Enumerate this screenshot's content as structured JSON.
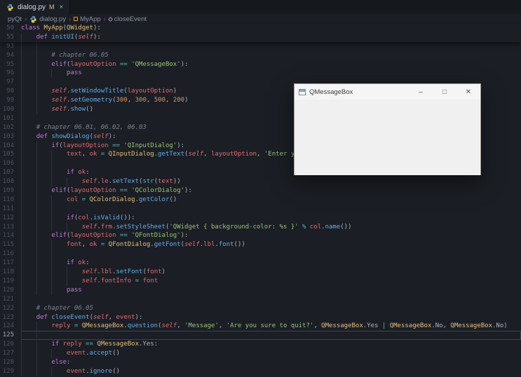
{
  "colors": {
    "bg": "#1b1e24",
    "panel": "#15181d",
    "text": "#abb2bf",
    "gutter": "#4b5263",
    "keyword": "#c678dd",
    "classname": "#e5c07b",
    "func": "#61afef",
    "string": "#98c379",
    "comment": "#7f848e",
    "number": "#d19a66",
    "variable": "#e06c75",
    "operator": "#56b6c2",
    "modified": "#e2c08d",
    "guide": "#2d333d",
    "breadcrumb": "#8a929e"
  },
  "tab": {
    "label": "dialog.py",
    "modified": "M",
    "close": "×"
  },
  "breadcrumb": {
    "separator": "›",
    "items": [
      {
        "label": "pyQt",
        "icon": ""
      },
      {
        "label": "dialog.py",
        "icon": "python"
      },
      {
        "label": "MyApp",
        "icon": "class"
      },
      {
        "label": "closeEvent",
        "icon": "method"
      }
    ]
  },
  "sticky": {
    "lines": [
      {
        "n": 50,
        "i": 0,
        "g": 0,
        "t": [
          [
            "class",
            "kw"
          ],
          [
            " ",
            "pl"
          ],
          [
            "MyApp",
            "cls"
          ],
          [
            "(",
            "pl"
          ],
          [
            "QWidget",
            "cls"
          ],
          [
            "):",
            "pl"
          ]
        ]
      },
      {
        "n": 55,
        "i": 4,
        "g": 1,
        "t": [
          [
            "def",
            "kw"
          ],
          [
            " ",
            "pl"
          ],
          [
            "initUI",
            "fn"
          ],
          [
            "(",
            "pl"
          ],
          [
            "self",
            "self"
          ],
          [
            "):",
            "pl"
          ]
        ]
      }
    ]
  },
  "code": {
    "current_line": 125,
    "lines": [
      {
        "n": 93,
        "i": 0,
        "g": 2,
        "t": []
      },
      {
        "n": 94,
        "i": 8,
        "g": 2,
        "t": [
          [
            "# chapter 06.05",
            "com"
          ]
        ]
      },
      {
        "n": 95,
        "i": 8,
        "g": 2,
        "t": [
          [
            "elif",
            "kw"
          ],
          [
            "(",
            "pl"
          ],
          [
            "layoutOption",
            "var"
          ],
          [
            " ",
            "pl"
          ],
          [
            "==",
            "op"
          ],
          [
            " ",
            "pl"
          ],
          [
            "'QMessageBox'",
            "str"
          ],
          [
            "):",
            "pl"
          ]
        ]
      },
      {
        "n": 96,
        "i": 12,
        "g": 3,
        "t": [
          [
            "pass",
            "kw"
          ]
        ]
      },
      {
        "n": 97,
        "i": 0,
        "g": 2,
        "t": []
      },
      {
        "n": 98,
        "i": 8,
        "g": 2,
        "t": [
          [
            "self",
            "self"
          ],
          [
            ".",
            "pl"
          ],
          [
            "setWindowTitle",
            "fn"
          ],
          [
            "(",
            "pl"
          ],
          [
            "layoutOption",
            "var"
          ],
          [
            ")",
            "pl"
          ]
        ]
      },
      {
        "n": 99,
        "i": 8,
        "g": 2,
        "t": [
          [
            "self",
            "self"
          ],
          [
            ".",
            "pl"
          ],
          [
            "setGeometry",
            "fn"
          ],
          [
            "(",
            "pl"
          ],
          [
            "300",
            "num"
          ],
          [
            ", ",
            "pl"
          ],
          [
            "300",
            "num"
          ],
          [
            ", ",
            "pl"
          ],
          [
            "500",
            "num"
          ],
          [
            ", ",
            "pl"
          ],
          [
            "200",
            "num"
          ],
          [
            ")",
            "pl"
          ]
        ]
      },
      {
        "n": 100,
        "i": 8,
        "g": 2,
        "t": [
          [
            "self",
            "self"
          ],
          [
            ".",
            "pl"
          ],
          [
            "show",
            "fn"
          ],
          [
            "()",
            "pl"
          ]
        ]
      },
      {
        "n": 101,
        "i": 0,
        "g": 1,
        "t": []
      },
      {
        "n": 102,
        "i": 4,
        "g": 1,
        "t": [
          [
            "# chapter 06.01, 06.02, 06.03",
            "com"
          ]
        ]
      },
      {
        "n": 103,
        "i": 4,
        "g": 1,
        "t": [
          [
            "def",
            "kw"
          ],
          [
            " ",
            "pl"
          ],
          [
            "showDialog",
            "fn"
          ],
          [
            "(",
            "pl"
          ],
          [
            "self",
            "self"
          ],
          [
            "):",
            "pl"
          ]
        ]
      },
      {
        "n": 104,
        "i": 8,
        "g": 2,
        "t": [
          [
            "if",
            "kw"
          ],
          [
            "(",
            "pl"
          ],
          [
            "layoutOption",
            "var"
          ],
          [
            " ",
            "pl"
          ],
          [
            "==",
            "op"
          ],
          [
            " ",
            "pl"
          ],
          [
            "'QInputDialog'",
            "str"
          ],
          [
            "):",
            "pl"
          ]
        ]
      },
      {
        "n": 105,
        "i": 12,
        "g": 3,
        "t": [
          [
            "text",
            "var"
          ],
          [
            ", ",
            "pl"
          ],
          [
            "ok",
            "var"
          ],
          [
            " ",
            "pl"
          ],
          [
            "=",
            "op"
          ],
          [
            " ",
            "pl"
          ],
          [
            "QInputDialog",
            "cls"
          ],
          [
            ".",
            "pl"
          ],
          [
            "getText",
            "fn"
          ],
          [
            "(",
            "pl"
          ],
          [
            "self",
            "self"
          ],
          [
            ", ",
            "pl"
          ],
          [
            "layoutOption",
            "var"
          ],
          [
            ", ",
            "pl"
          ],
          [
            "'Enter yo",
            "str"
          ]
        ]
      },
      {
        "n": 106,
        "i": 0,
        "g": 3,
        "t": []
      },
      {
        "n": 107,
        "i": 12,
        "g": 3,
        "t": [
          [
            "if",
            "kw"
          ],
          [
            " ",
            "pl"
          ],
          [
            "ok",
            "var"
          ],
          [
            ":",
            "pl"
          ]
        ]
      },
      {
        "n": 108,
        "i": 16,
        "g": 4,
        "t": [
          [
            "self",
            "self"
          ],
          [
            ".",
            "pl"
          ],
          [
            "le",
            "var"
          ],
          [
            ".",
            "pl"
          ],
          [
            "setText",
            "fn"
          ],
          [
            "(",
            "pl"
          ],
          [
            "str",
            "bi"
          ],
          [
            "(",
            "pl"
          ],
          [
            "text",
            "var"
          ],
          [
            "))",
            "pl"
          ]
        ]
      },
      {
        "n": 109,
        "i": 8,
        "g": 2,
        "t": [
          [
            "elif",
            "kw"
          ],
          [
            "(",
            "pl"
          ],
          [
            "layoutOption",
            "var"
          ],
          [
            " ",
            "pl"
          ],
          [
            "==",
            "op"
          ],
          [
            " ",
            "pl"
          ],
          [
            "'QColorDialog'",
            "str"
          ],
          [
            "):",
            "pl"
          ]
        ]
      },
      {
        "n": 110,
        "i": 12,
        "g": 3,
        "t": [
          [
            "col",
            "var"
          ],
          [
            " ",
            "pl"
          ],
          [
            "=",
            "op"
          ],
          [
            " ",
            "pl"
          ],
          [
            "QColorDialog",
            "cls"
          ],
          [
            ".",
            "pl"
          ],
          [
            "getColor",
            "fn"
          ],
          [
            "()",
            "pl"
          ]
        ]
      },
      {
        "n": 111,
        "i": 0,
        "g": 3,
        "t": []
      },
      {
        "n": 112,
        "i": 12,
        "g": 3,
        "t": [
          [
            "if",
            "kw"
          ],
          [
            "(",
            "pl"
          ],
          [
            "col",
            "var"
          ],
          [
            ".",
            "pl"
          ],
          [
            "isValid",
            "fn"
          ],
          [
            "()):",
            "pl"
          ]
        ]
      },
      {
        "n": 113,
        "i": 16,
        "g": 4,
        "t": [
          [
            "self",
            "self"
          ],
          [
            ".",
            "pl"
          ],
          [
            "frm",
            "var"
          ],
          [
            ".",
            "pl"
          ],
          [
            "setStyleSheet",
            "fn"
          ],
          [
            "(",
            "pl"
          ],
          [
            "'QWidget { background-color: %s }'",
            "str"
          ],
          [
            " ",
            "pl"
          ],
          [
            "%",
            "op"
          ],
          [
            " ",
            "pl"
          ],
          [
            "col",
            "var"
          ],
          [
            ".",
            "pl"
          ],
          [
            "name",
            "fn"
          ],
          [
            "())",
            "pl"
          ]
        ]
      },
      {
        "n": 114,
        "i": 8,
        "g": 2,
        "t": [
          [
            "elif",
            "kw"
          ],
          [
            "(",
            "pl"
          ],
          [
            "layoutOption",
            "var"
          ],
          [
            " ",
            "pl"
          ],
          [
            "==",
            "op"
          ],
          [
            " ",
            "pl"
          ],
          [
            "'QFontDialog'",
            "str"
          ],
          [
            "):",
            "pl"
          ]
        ]
      },
      {
        "n": 115,
        "i": 12,
        "g": 3,
        "t": [
          [
            "font",
            "var"
          ],
          [
            ", ",
            "pl"
          ],
          [
            "ok",
            "var"
          ],
          [
            " ",
            "pl"
          ],
          [
            "=",
            "op"
          ],
          [
            " ",
            "pl"
          ],
          [
            "QFontDialog",
            "cls"
          ],
          [
            ".",
            "pl"
          ],
          [
            "getFont",
            "fn"
          ],
          [
            "(",
            "pl"
          ],
          [
            "self",
            "self"
          ],
          [
            ".",
            "pl"
          ],
          [
            "lbl",
            "var"
          ],
          [
            ".",
            "pl"
          ],
          [
            "font",
            "fn"
          ],
          [
            "())",
            "pl"
          ]
        ]
      },
      {
        "n": 116,
        "i": 0,
        "g": 3,
        "t": []
      },
      {
        "n": 117,
        "i": 12,
        "g": 3,
        "t": [
          [
            "if",
            "kw"
          ],
          [
            " ",
            "pl"
          ],
          [
            "ok",
            "var"
          ],
          [
            ":",
            "pl"
          ]
        ]
      },
      {
        "n": 118,
        "i": 16,
        "g": 4,
        "t": [
          [
            "self",
            "self"
          ],
          [
            ".",
            "pl"
          ],
          [
            "lbl",
            "var"
          ],
          [
            ".",
            "pl"
          ],
          [
            "setFont",
            "fn"
          ],
          [
            "(",
            "pl"
          ],
          [
            "font",
            "var"
          ],
          [
            ")",
            "pl"
          ]
        ]
      },
      {
        "n": 119,
        "i": 16,
        "g": 4,
        "t": [
          [
            "self",
            "self"
          ],
          [
            ".",
            "pl"
          ],
          [
            "fontInfo",
            "var"
          ],
          [
            " ",
            "pl"
          ],
          [
            "=",
            "op"
          ],
          [
            " ",
            "pl"
          ],
          [
            "font",
            "var"
          ]
        ]
      },
      {
        "n": 120,
        "i": 12,
        "g": 3,
        "t": [
          [
            "pass",
            "kw"
          ]
        ]
      },
      {
        "n": 121,
        "i": 0,
        "g": 1,
        "t": []
      },
      {
        "n": 122,
        "i": 4,
        "g": 1,
        "t": [
          [
            "# chapter 06.05",
            "com"
          ]
        ]
      },
      {
        "n": 123,
        "i": 4,
        "g": 1,
        "t": [
          [
            "def",
            "kw"
          ],
          [
            " ",
            "pl"
          ],
          [
            "closeEvent",
            "fn"
          ],
          [
            "(",
            "pl"
          ],
          [
            "self",
            "self"
          ],
          [
            ", ",
            "pl"
          ],
          [
            "event",
            "var"
          ],
          [
            "):",
            "pl"
          ]
        ]
      },
      {
        "n": 124,
        "i": 8,
        "g": 2,
        "t": [
          [
            "reply",
            "var"
          ],
          [
            " ",
            "pl"
          ],
          [
            "=",
            "op"
          ],
          [
            " ",
            "pl"
          ],
          [
            "QMessageBox",
            "cls"
          ],
          [
            ".",
            "pl"
          ],
          [
            "question",
            "fn"
          ],
          [
            "(",
            "pl"
          ],
          [
            "self",
            "self"
          ],
          [
            ", ",
            "pl"
          ],
          [
            "'Message'",
            "str"
          ],
          [
            ", ",
            "pl"
          ],
          [
            "'Are you sure to quit?'",
            "str"
          ],
          [
            ", ",
            "pl"
          ],
          [
            "QMessageBox",
            "cls"
          ],
          [
            ".Yes ",
            "pl"
          ],
          [
            "|",
            "op"
          ],
          [
            " ",
            "pl"
          ],
          [
            "QMessageBox",
            "cls"
          ],
          [
            ".No, ",
            "pl"
          ],
          [
            "QMessageBox",
            "cls"
          ],
          [
            ".No)",
            "pl"
          ]
        ]
      },
      {
        "n": 125,
        "i": 0,
        "g": 2,
        "t": []
      },
      {
        "n": 126,
        "i": 8,
        "g": 2,
        "t": [
          [
            "if",
            "kw"
          ],
          [
            " ",
            "pl"
          ],
          [
            "reply",
            "var"
          ],
          [
            " ",
            "pl"
          ],
          [
            "==",
            "op"
          ],
          [
            " ",
            "pl"
          ],
          [
            "QMessageBox",
            "cls"
          ],
          [
            ".Yes:",
            "pl"
          ]
        ]
      },
      {
        "n": 127,
        "i": 12,
        "g": 3,
        "t": [
          [
            "event",
            "var"
          ],
          [
            ".",
            "pl"
          ],
          [
            "accept",
            "fn"
          ],
          [
            "()",
            "pl"
          ]
        ]
      },
      {
        "n": 128,
        "i": 8,
        "g": 2,
        "t": [
          [
            "else",
            "kw"
          ],
          [
            ":",
            "pl"
          ]
        ]
      },
      {
        "n": 129,
        "i": 12,
        "g": 3,
        "t": [
          [
            "event",
            "var"
          ],
          [
            ".",
            "pl"
          ],
          [
            "ignore",
            "fn"
          ],
          [
            "()",
            "pl"
          ]
        ]
      }
    ]
  },
  "dialog": {
    "title": "QMessageBox",
    "controls": {
      "minimize": "–",
      "maximize": "□",
      "close": "✕"
    }
  }
}
